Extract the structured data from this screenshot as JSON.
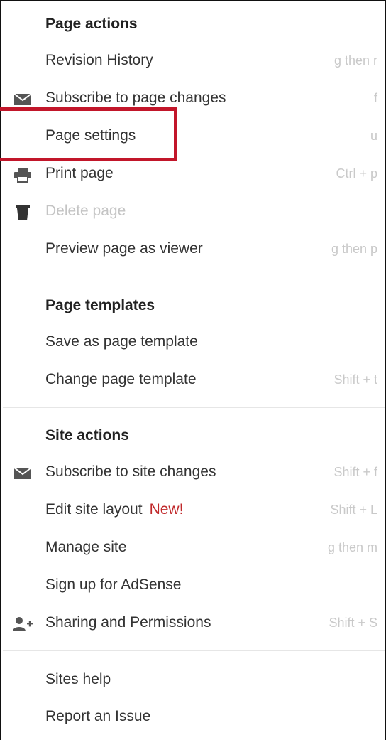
{
  "colors": {
    "panel_border": "#111111",
    "label_text": "#333333",
    "header_text": "#222222",
    "shortcut_text": "#c9c9c9",
    "disabled_text": "#c4c4c4",
    "new_badge": "#c0292b",
    "highlight_box": "#c2162a",
    "divider": "#e6e6e6",
    "icon": "#555555"
  },
  "page_actions": {
    "header": "Page actions",
    "items": [
      {
        "label": "Revision History",
        "shortcut": "g then r"
      },
      {
        "label": "Subscribe to page changes",
        "shortcut": "f",
        "icon": "envelope-icon"
      },
      {
        "label": "Page settings",
        "shortcut": "u",
        "highlighted": true
      },
      {
        "label": "Print page",
        "shortcut": "Ctrl + p",
        "icon": "printer-icon"
      },
      {
        "label": "Delete page",
        "shortcut": "",
        "icon": "trash-icon",
        "disabled": true
      },
      {
        "label": "Preview page as viewer",
        "shortcut": "g then p"
      }
    ]
  },
  "page_templates": {
    "header": "Page templates",
    "items": [
      {
        "label": "Save as page template",
        "shortcut": ""
      },
      {
        "label": "Change page template",
        "shortcut": "Shift + t"
      }
    ]
  },
  "site_actions": {
    "header": "Site actions",
    "items": [
      {
        "label": "Subscribe to site changes",
        "shortcut": "Shift + f",
        "icon": "envelope-icon"
      },
      {
        "label": "Edit site layout",
        "badge": "New!",
        "shortcut": "Shift + L"
      },
      {
        "label": "Manage site",
        "shortcut": "g then m"
      },
      {
        "label": "Sign up for AdSense",
        "shortcut": ""
      },
      {
        "label": "Sharing and Permissions",
        "shortcut": "Shift + S",
        "icon": "add-person-icon"
      }
    ]
  },
  "help": {
    "items": [
      {
        "label": "Sites help"
      },
      {
        "label": "Report an Issue"
      }
    ]
  }
}
